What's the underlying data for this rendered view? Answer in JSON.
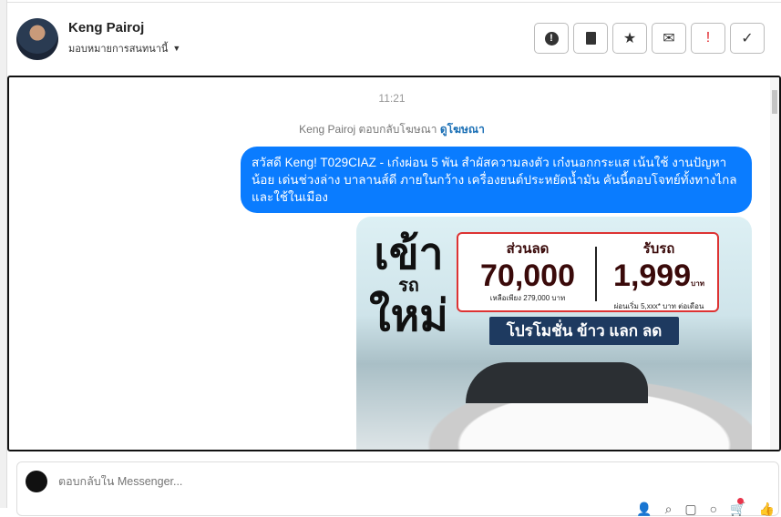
{
  "header": {
    "name": "Keng Pairoj",
    "assign_label": "มอบหมายการสนทนานี้",
    "actions": [
      {
        "icon": "alert-circle-icon",
        "glyph": "❗"
      },
      {
        "icon": "trash-icon",
        "glyph": "🗑"
      },
      {
        "icon": "star-icon",
        "glyph": "★"
      },
      {
        "icon": "envelope-icon",
        "glyph": "✉"
      },
      {
        "icon": "exclamation-icon",
        "glyph": "!"
      },
      {
        "icon": "check-icon",
        "glyph": "✓"
      }
    ]
  },
  "chat": {
    "time": "11:21",
    "reply_note": "Keng Pairoj ตอบกลับโฆษณา",
    "reply_link": "ดูโฆษณา",
    "message": "สวัสดี Keng! T029CIAZ - เก๋งผ่อน 5 พัน สำผัสความลงตัว เก๋งนอกกระแส เน้นใช้ งานปัญหาน้อย เด่นช่วงล่าง บาลานส์ดี ภายในกว้าง เครื่องยนต์ประหยัดน้ำมัน คันนี้ตอบโจทย์ทั้งทางไกลและใช้ในเมือง",
    "ad": {
      "headline_top": "เข้า",
      "headline_mid": "รถ",
      "headline_bottom": "ใหม่",
      "discount_label": "ส่วนลด",
      "discount_value": "70,000",
      "discount_note": "เหลือเพียง 279,000 บาท",
      "get_car_label": "รับรถ",
      "get_car_value": "1,999",
      "get_car_unit": "บาท",
      "get_car_note": "ผ่อนเริ่ม 5,xxx* บาท ต่อเดือน",
      "promo": "โปรโมชั่น ข้าว แลก ลด"
    }
  },
  "composer": {
    "placeholder": "ตอบกลับใน Messenger..."
  }
}
